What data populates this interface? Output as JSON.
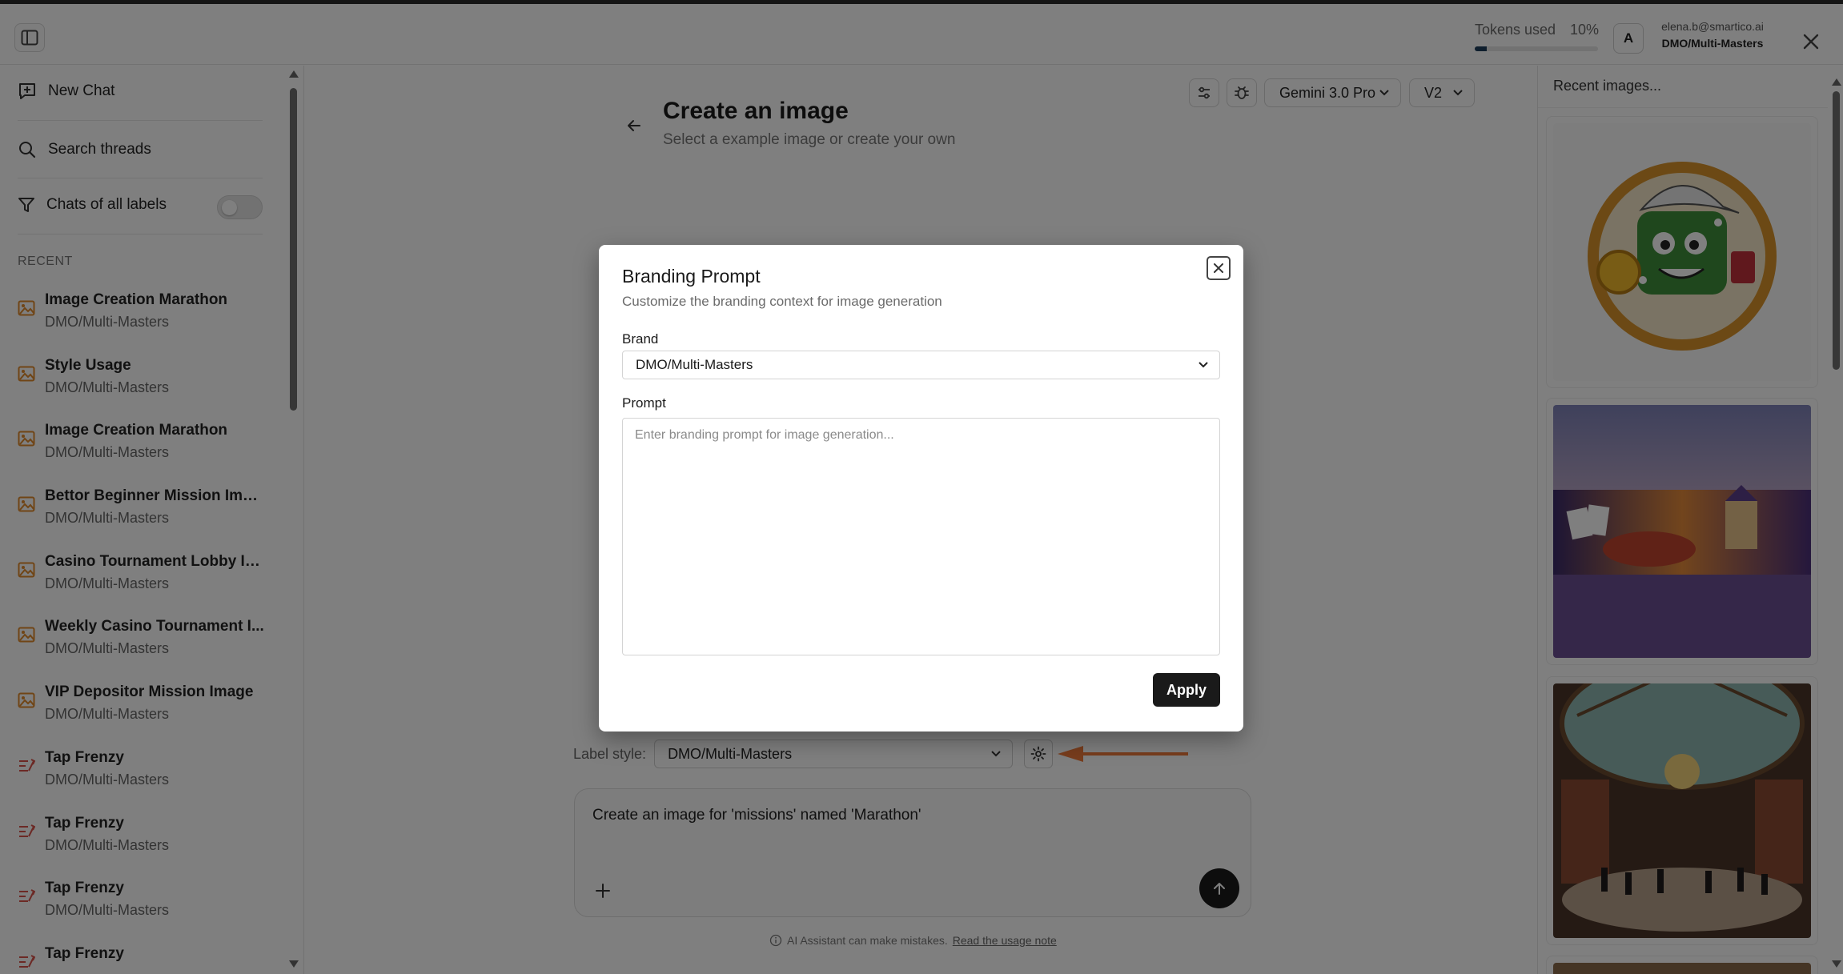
{
  "header": {
    "tokens_label": "Tokens used",
    "tokens_percent_label": "10%",
    "tokens_fraction": 0.1,
    "avatar_initial": "A",
    "user_email": "elena.b@smartico.ai",
    "user_org": "DMO/Multi-Masters"
  },
  "sidebar": {
    "new_chat": "New Chat",
    "search": "Search threads",
    "filter_label": "Chats of all labels",
    "recent_label": "RECENT",
    "threads": [
      {
        "title": "Image Creation Marathon",
        "sub": "DMO/Multi-Masters",
        "icon": "image-icon"
      },
      {
        "title": "Style Usage",
        "sub": "DMO/Multi-Masters",
        "icon": "image-icon"
      },
      {
        "title": "Image Creation Marathon",
        "sub": "DMO/Multi-Masters",
        "icon": "image-icon"
      },
      {
        "title": "Bettor Beginner Mission Image",
        "sub": "DMO/Multi-Masters",
        "icon": "image-icon"
      },
      {
        "title": "Casino Tournament Lobby Im...",
        "sub": "DMO/Multi-Masters",
        "icon": "image-icon"
      },
      {
        "title": "Weekly Casino Tournament I...",
        "sub": "DMO/Multi-Masters",
        "icon": "image-icon"
      },
      {
        "title": "VIP Depositor Mission Image",
        "sub": "DMO/Multi-Masters",
        "icon": "image-icon"
      },
      {
        "title": "Tap Frenzy",
        "sub": "DMO/Multi-Masters",
        "icon": "game-icon"
      },
      {
        "title": "Tap Frenzy",
        "sub": "DMO/Multi-Masters",
        "icon": "game-icon"
      },
      {
        "title": "Tap Frenzy",
        "sub": "DMO/Multi-Masters",
        "icon": "game-icon"
      },
      {
        "title": "Tap Frenzy",
        "sub": "",
        "icon": "game-icon"
      }
    ]
  },
  "main": {
    "title": "Create an image",
    "subtitle": "Select a example image or create your own",
    "model": "Gemini 3.0 Pro",
    "version": "V2",
    "label_style_label": "Label style:",
    "label_style_value": "DMO/Multi-Masters",
    "composer_text": "Create an image for 'missions' named 'Marathon'",
    "disclaimer": "AI Assistant can make mistakes.",
    "disclaimer_link": "Read the usage note"
  },
  "right_panel": {
    "title": "Recent images..."
  },
  "modal": {
    "title": "Branding Prompt",
    "subtitle": "Customize the branding context for image generation",
    "brand_label": "Brand",
    "brand_value": "DMO/Multi-Masters",
    "prompt_label": "Prompt",
    "prompt_placeholder": "Enter branding prompt for image generation...",
    "prompt_value": "",
    "apply": "Apply"
  },
  "colors": {
    "accent_arrow": "#f07a3a",
    "thread_icon": "#e08a2c",
    "primary_button": "#1a1a1a",
    "overlay": "rgba(0,0,0,0.5)"
  }
}
